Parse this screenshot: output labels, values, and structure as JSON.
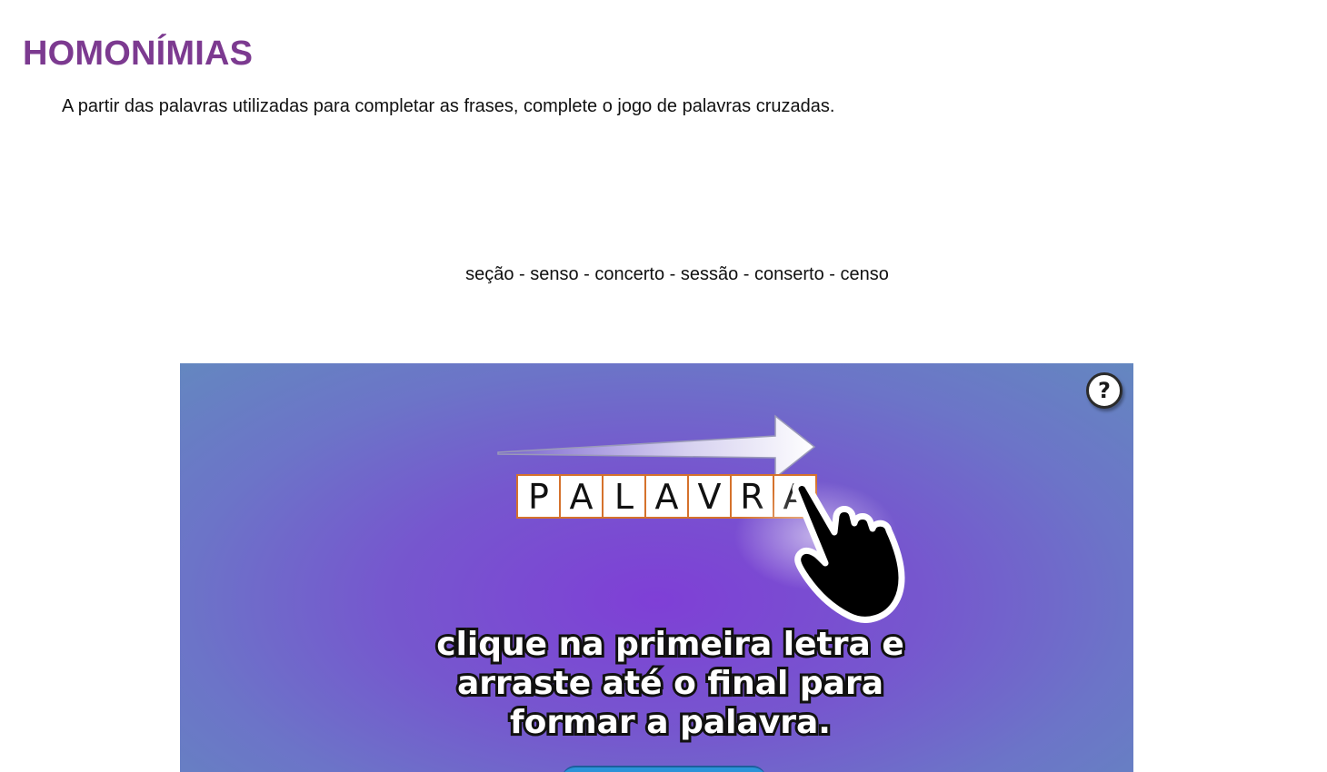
{
  "page": {
    "title": "HOMONÍMIAS",
    "instruction": "A partir das palavras utilizadas para completar as frases, complete o jogo de palavras cruzadas.",
    "word_list": "seção - senso - concerto - sessão - conserto - censo"
  },
  "game": {
    "help_label": "?",
    "demo_letters": [
      "P",
      "A",
      "L",
      "A",
      "V",
      "R",
      "A"
    ],
    "instruction_lines": [
      "clique na primeira letra e",
      "arraste até o final para",
      "formar a palavra."
    ],
    "colors": {
      "title": "#7c3a90",
      "background_center": "#7f3fd6",
      "background_edge": "#6487c0",
      "cell_border": "#d5722c"
    },
    "icons": [
      "question-icon",
      "arrow-icon",
      "pointing-hand-icon"
    ]
  }
}
